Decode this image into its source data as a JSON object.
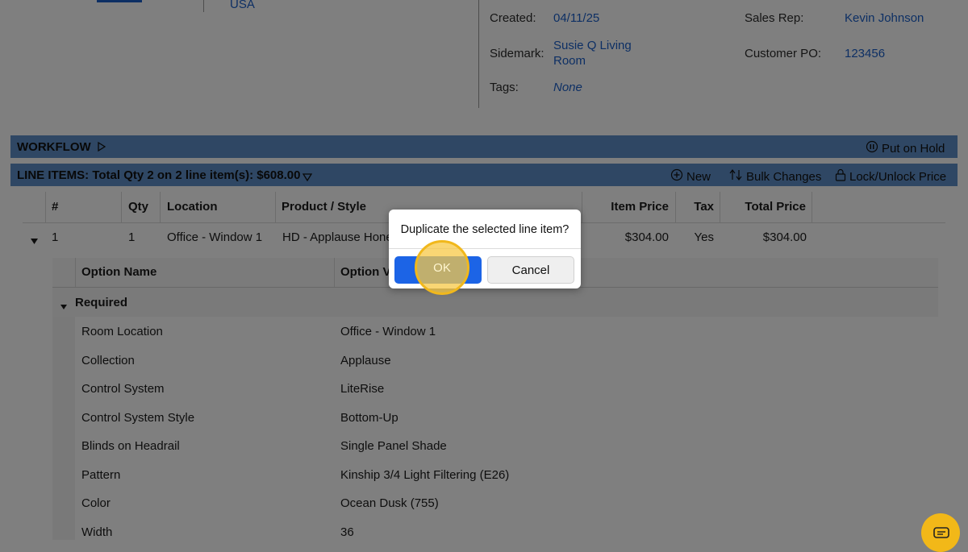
{
  "header": {
    "country": "USA",
    "created_label": "Created:",
    "created_value": "04/11/25",
    "sidemark_label": "Sidemark:",
    "sidemark_line1": "Susie Q Living",
    "sidemark_line2": "Room",
    "tags_label": "Tags:",
    "tags_value": "None",
    "sales_rep_label": "Sales Rep:",
    "sales_rep_value": "Kevin Johnson",
    "customer_po_label": "Customer PO:",
    "customer_po_value": "123456"
  },
  "workflow": {
    "title": "WORKFLOW",
    "put_on_hold": "Put on Hold"
  },
  "line_items": {
    "title": "LINE ITEMS: Total Qty 2 on 2 line item(s): $608.00",
    "new_label": "New",
    "bulk_changes_label": "Bulk Changes",
    "lock_unlock_label": "Lock/Unlock Price",
    "columns": [
      "#",
      "Qty",
      "Location",
      "Product / Style",
      "Item Price",
      "Tax",
      "Total Price"
    ],
    "row": {
      "num": "1",
      "qty": "1",
      "location": "Office - Window 1",
      "product": "HD - Applause Hone",
      "item_price": "$304.00",
      "tax": "Yes",
      "total_price": "$304.00"
    }
  },
  "options": {
    "col_name": "Option Name",
    "col_value": "Option V",
    "group": "Required",
    "rows": [
      {
        "name": "Room Location",
        "value": "Office - Window 1"
      },
      {
        "name": "Collection",
        "value": "Applause"
      },
      {
        "name": "Control System",
        "value": "LiteRise"
      },
      {
        "name": "Control System Style",
        "value": "Bottom-Up"
      },
      {
        "name": "Blinds on Headrail",
        "value": "Single Panel Shade"
      },
      {
        "name": "Pattern",
        "value": "Kinship 3/4 Light Filtering (E26)"
      },
      {
        "name": "Color",
        "value": "Ocean Dusk (755)"
      },
      {
        "name": "Width",
        "value": "36"
      }
    ]
  },
  "dialog": {
    "message": "Duplicate the selected line item?",
    "ok_label": "OK",
    "cancel_label": "Cancel"
  },
  "colors": {
    "accent_blue": "#1c64e6",
    "link_blue": "#1a5fc9",
    "bar_blue": "#5f8fc9",
    "highlight_yellow": "#f1b81c"
  }
}
